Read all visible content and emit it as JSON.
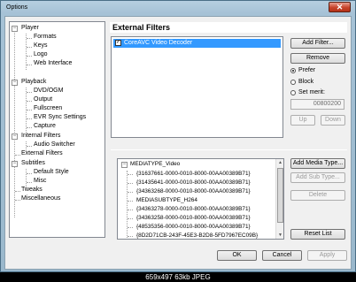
{
  "window": {
    "title": "Options",
    "close_glyph": "✕"
  },
  "tree": {
    "items": [
      {
        "label": "Player",
        "level": 0,
        "expanded": true
      },
      {
        "label": "Formats",
        "level": 1
      },
      {
        "label": "Keys",
        "level": 1
      },
      {
        "label": "Logo",
        "level": 1
      },
      {
        "label": "Web Interface",
        "level": 1
      },
      {
        "label": "Playback",
        "level": 0,
        "expanded": true
      },
      {
        "label": "DVD/OGM",
        "level": 1
      },
      {
        "label": "Output",
        "level": 1
      },
      {
        "label": "Fullscreen",
        "level": 1
      },
      {
        "label": "EVR Sync Settings",
        "level": 1
      },
      {
        "label": "Capture",
        "level": 1
      },
      {
        "label": "Internal Filters",
        "level": 0,
        "expanded": true
      },
      {
        "label": "Audio Switcher",
        "level": 1
      },
      {
        "label": "External Filters",
        "level": 0
      },
      {
        "label": "Subtitles",
        "level": 0,
        "expanded": true
      },
      {
        "label": "Default Style",
        "level": 1
      },
      {
        "label": "Misc",
        "level": 1
      },
      {
        "label": "Tweaks",
        "level": 0
      },
      {
        "label": "Miscellaneous",
        "level": 0
      }
    ]
  },
  "page": {
    "header": "External Filters"
  },
  "filters": {
    "items": [
      {
        "name": "CoreAVC Video Decoder",
        "checked": true
      }
    ]
  },
  "buttons": {
    "add_filter": "Add Filter...",
    "remove": "Remove",
    "up": "Up",
    "down": "Down",
    "add_media_type": "Add Media Type...",
    "add_sub_type": "Add Sub Type...",
    "delete": "Delete",
    "reset_list": "Reset List",
    "ok": "OK",
    "cancel": "Cancel",
    "apply": "Apply"
  },
  "merit": {
    "prefer": "Prefer",
    "block": "Block",
    "set_merit": "Set merit:",
    "value": "00800200",
    "selected": "prefer"
  },
  "media_types": {
    "root": "MEDIATYPE_Video",
    "items": [
      "{31637661-0000-0010-8000-00AA00389B71}",
      "{31435641-0000-0010-8000-00AA00389B71}",
      "{34363268-0000-0010-8000-00AA00389B71}",
      "MEDIASUBTYPE_H264",
      "{34363278-0000-0010-8000-00AA00389B71}",
      "{34363258-0000-0010-8000-00AA00389B71}",
      "{48535356-0000-0010-8000-00AA00389B71}",
      "{8D2D71CB-243F-45E3-B2D8-5FD7967EC09B}"
    ]
  },
  "caption": "659x497  63kb  JPEG",
  "colors": {
    "selection": "#3399ff",
    "title_bar": "#a6c2d6",
    "close_button": "#c7432a"
  }
}
